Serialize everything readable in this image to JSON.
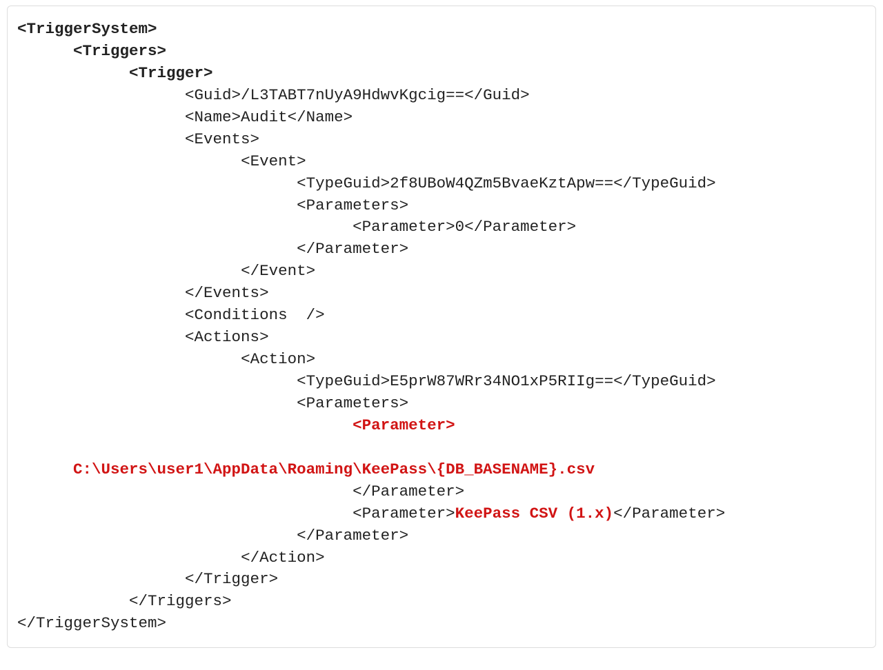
{
  "lines": [
    {
      "indent": 0,
      "segs": [
        {
          "t": "<TriggerSystem>",
          "b": true
        }
      ]
    },
    {
      "indent": 1,
      "segs": [
        {
          "t": "<Triggers>",
          "b": true
        }
      ]
    },
    {
      "indent": 2,
      "segs": [
        {
          "t": "<Trigger>",
          "b": true
        }
      ]
    },
    {
      "indent": 3,
      "segs": [
        {
          "t": "<Guid>/L3TABT7nUyA9HdwvKgcig==</Guid>"
        }
      ]
    },
    {
      "indent": 3,
      "segs": [
        {
          "t": "<Name>Audit</Name>"
        }
      ]
    },
    {
      "indent": 3,
      "segs": [
        {
          "t": "<Events>"
        }
      ]
    },
    {
      "indent": 4,
      "segs": [
        {
          "t": "<Event>"
        }
      ]
    },
    {
      "indent": 5,
      "segs": [
        {
          "t": "<TypeGuid>2f8UBoW4QZm5BvaeKztApw==</TypeGuid>"
        }
      ]
    },
    {
      "indent": 5,
      "segs": [
        {
          "t": "<Parameters>"
        }
      ]
    },
    {
      "indent": 6,
      "segs": [
        {
          "t": "<Parameter>0</Parameter>"
        }
      ]
    },
    {
      "indent": 5,
      "segs": [
        {
          "t": "</Parameter>"
        }
      ]
    },
    {
      "indent": 4,
      "segs": [
        {
          "t": "</Event>"
        }
      ]
    },
    {
      "indent": 3,
      "segs": [
        {
          "t": "</Events>"
        }
      ]
    },
    {
      "indent": 3,
      "segs": [
        {
          "t": "<Conditions  />"
        }
      ]
    },
    {
      "indent": 3,
      "segs": [
        {
          "t": "<Actions>"
        }
      ]
    },
    {
      "indent": 4,
      "segs": [
        {
          "t": "<Action>"
        }
      ]
    },
    {
      "indent": 5,
      "segs": [
        {
          "t": "<TypeGuid>E5prW87WRr34NO1xP5RIIg==</TypeGuid>"
        }
      ]
    },
    {
      "indent": 5,
      "segs": [
        {
          "t": "<Parameters>"
        }
      ]
    },
    {
      "indent": 6,
      "segs": [
        {
          "t": "<Parameter>",
          "red": true,
          "b": true
        }
      ]
    },
    {
      "indent": 0,
      "segs": [
        {
          "t": " "
        }
      ]
    },
    {
      "indent": 1,
      "segs": [
        {
          "t": "C:\\Users\\user1\\AppData\\Roaming\\KeePass\\{DB_BASENAME}.csv",
          "red": true,
          "b": true
        }
      ]
    },
    {
      "indent": 6,
      "segs": [
        {
          "t": "</Parameter>"
        }
      ]
    },
    {
      "indent": 6,
      "segs": [
        {
          "t": "<Parameter>"
        },
        {
          "t": "KeePass CSV (1.x)",
          "red": true,
          "b": true
        },
        {
          "t": "</Parameter>"
        }
      ]
    },
    {
      "indent": 5,
      "segs": [
        {
          "t": "</Parameter>"
        }
      ]
    },
    {
      "indent": 4,
      "segs": [
        {
          "t": "</Action>"
        }
      ]
    },
    {
      "indent": 3,
      "segs": [
        {
          "t": "</Trigger>"
        }
      ]
    },
    {
      "indent": 2,
      "segs": [
        {
          "t": "</Triggers>"
        }
      ]
    },
    {
      "indent": 0,
      "segs": [
        {
          "t": "</TriggerSystem>"
        }
      ]
    }
  ],
  "indent_unit": "      "
}
